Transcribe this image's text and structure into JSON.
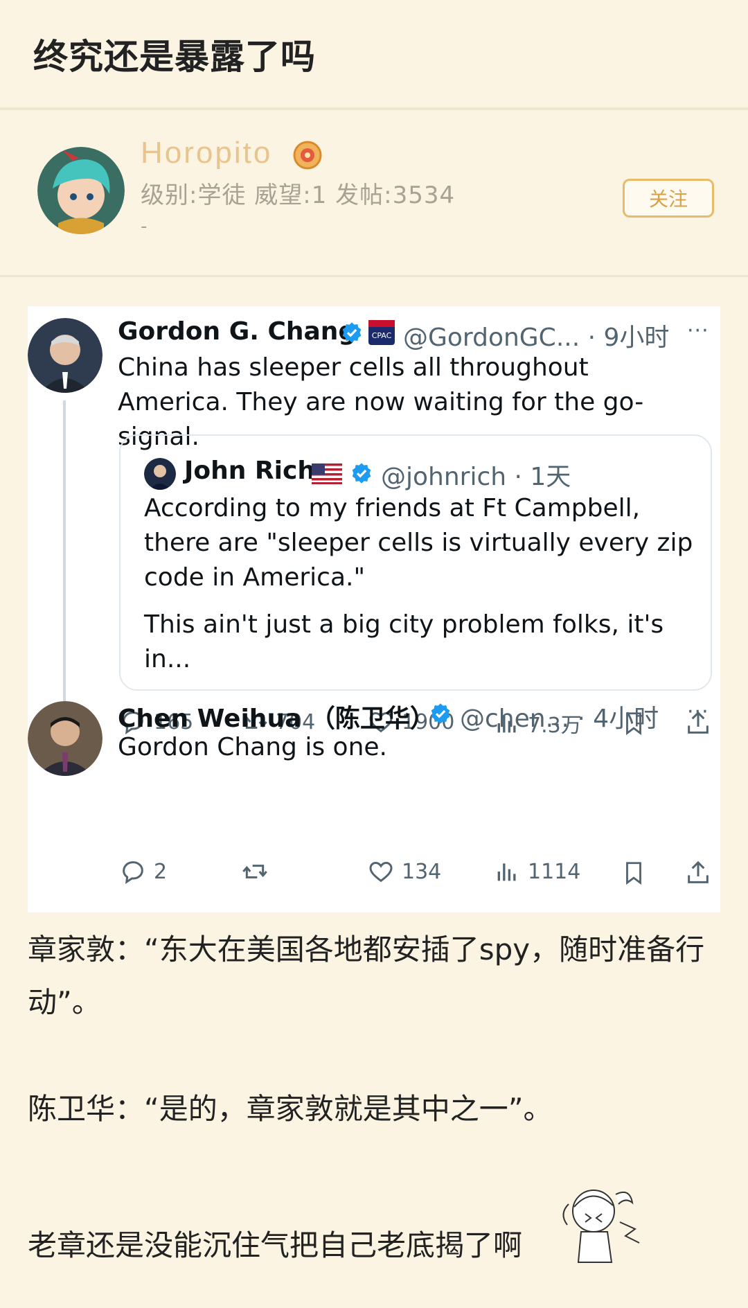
{
  "post": {
    "title": "终究还是暴露了吗",
    "author": {
      "name": "Horopito",
      "stats": "级别:学徒 威望:1 发帖:3534",
      "extra": "-",
      "follow_label": "关注"
    }
  },
  "embedded_tweet": {
    "main": {
      "name": "Gordon G. Chang",
      "handle_time": "@GordonGC... · 9小时",
      "text": "China has sleeper cells all throughout America. They are now waiting for the go-signal.",
      "actions": {
        "reply": "165",
        "retweet": "704",
        "like": "1900",
        "views": "7.3万"
      }
    },
    "quoted": {
      "name": "John Rich",
      "handle_time": "@johnrich · 1天",
      "text1": "According to my friends at Ft Campbell, there are \"sleeper cells is virtually every zip code in America.\"",
      "text2": "This ain't just a big city problem folks, it's in..."
    },
    "reply": {
      "name": "Chen Weihua （陈卫华）",
      "handle_time": "@chen... · 4小时",
      "text": "Gordon Chang is one.",
      "actions": {
        "reply": "2",
        "retweet": "",
        "like": "134",
        "views": "1114"
      }
    }
  },
  "body": {
    "p1": "章家敦：“东大在美国各地都安插了spy，随时准备行动”。",
    "p2": "陈卫华：“是的，章家敦就是其中之一”。",
    "p3": "老章还是没能沉住气把自己老底揭了啊"
  },
  "colors": {
    "background": "#fbf4e2",
    "username": "#e8c48e",
    "follow": "#e6bb6a",
    "verified": "#1d9bf0"
  },
  "icons": [
    "reply-icon",
    "retweet-icon",
    "like-icon",
    "views-icon",
    "bookmark-icon",
    "share-icon",
    "verified-icon",
    "more-icon",
    "us-flag-icon",
    "badge-icon"
  ]
}
